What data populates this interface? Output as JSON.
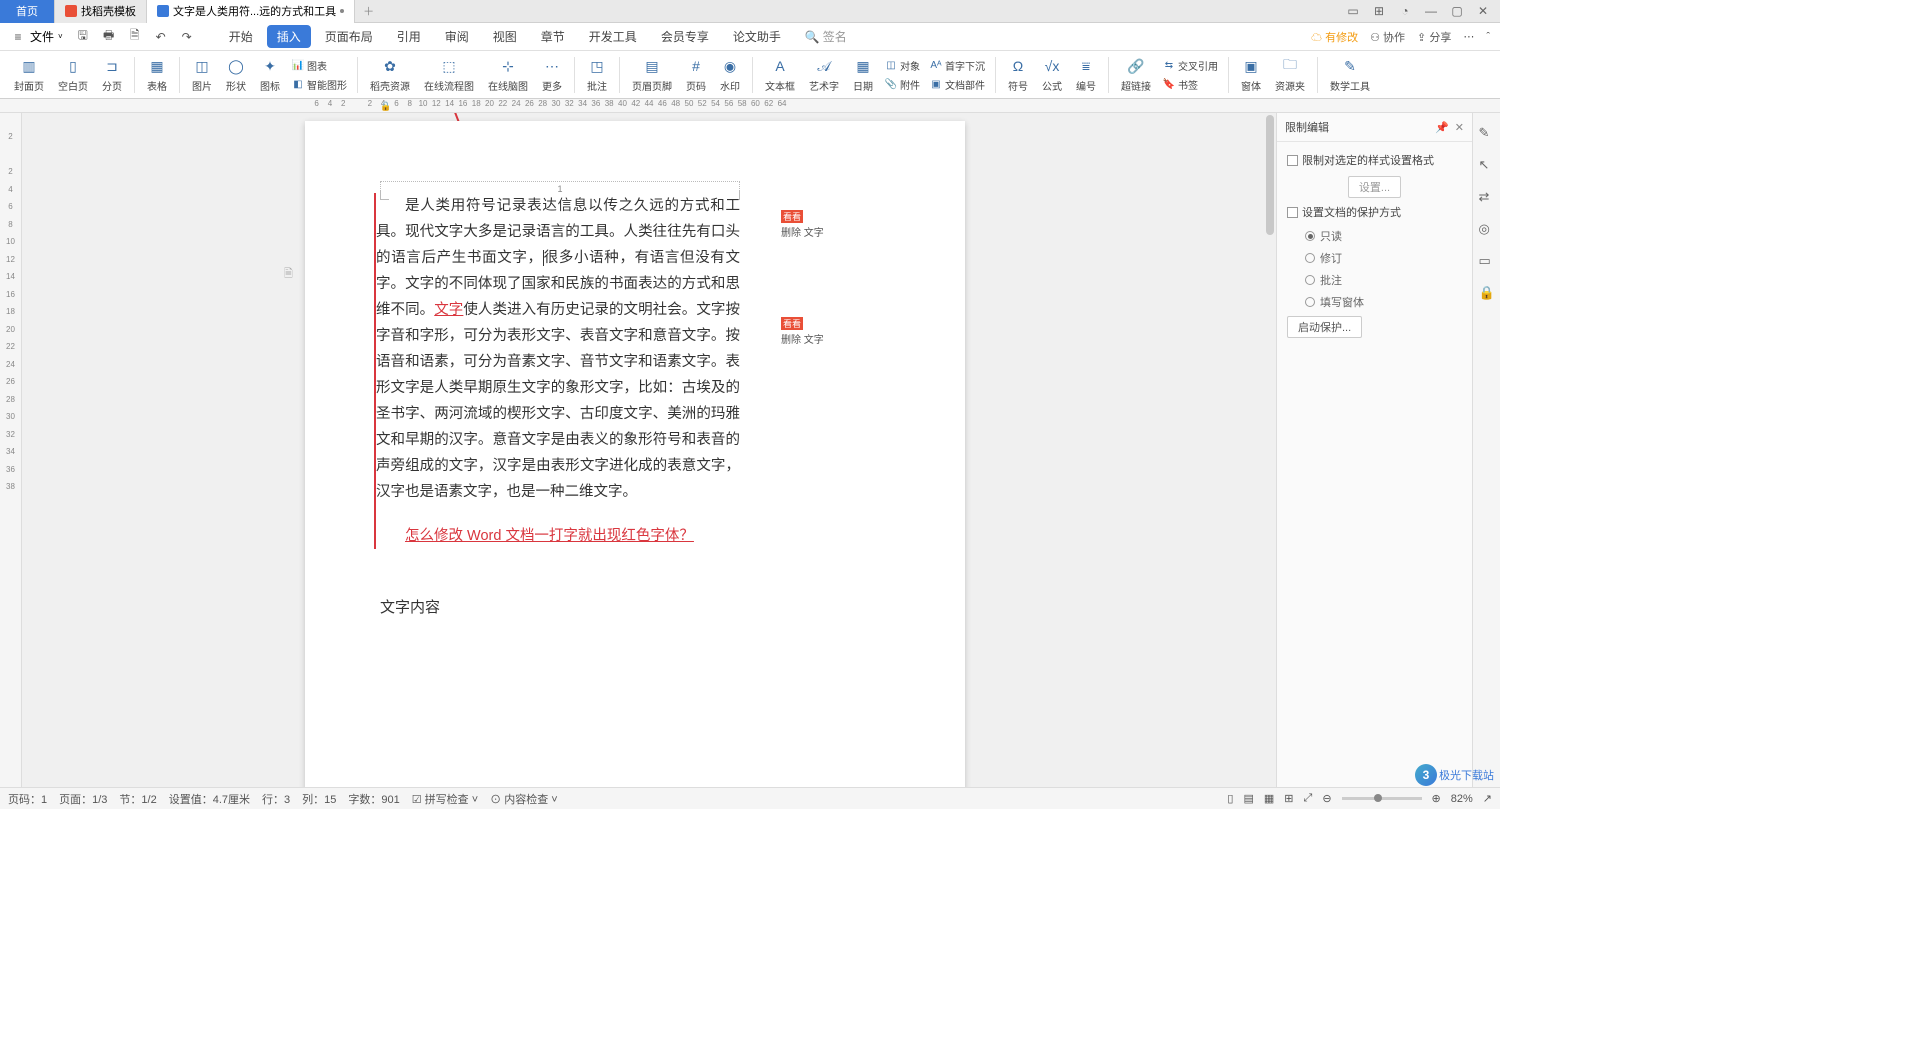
{
  "tabs": {
    "home": "首页",
    "templates": "找稻壳模板",
    "doc": "文字是人类用符...远的方式和工具"
  },
  "menu": {
    "file": "文件",
    "items": [
      "开始",
      "插入",
      "页面布局",
      "引用",
      "审阅",
      "视图",
      "章节",
      "开发工具",
      "会员专享",
      "论文助手"
    ],
    "active_index": 1,
    "sign": "签名",
    "right": {
      "track": "有修改",
      "collab": "协作",
      "share": "分享"
    }
  },
  "ribbon": {
    "cover": "封面页",
    "blank": "空白页",
    "section": "分页",
    "table": "表格",
    "image": "图片",
    "shape": "形状",
    "icon": "图标",
    "chart": "图表",
    "smart": "智能图形",
    "res": "稻壳资源",
    "flow": "在线流程图",
    "mind": "在线脑图",
    "more": "更多",
    "comment": "批注",
    "header": "页眉页脚",
    "pagenum": "页码",
    "water": "水印",
    "textbox": "文本框",
    "art": "艺术字",
    "date": "日期",
    "side1": "对象",
    "side2": "附件",
    "side3": "首字下沉",
    "side4": "文档部件",
    "symbol": "符号",
    "formula": "公式",
    "number": "编号",
    "hyper": "超链接",
    "cross": "交叉引用",
    "bookmark": "书签",
    "widget": "窗体",
    "resource": "资源夹",
    "teach": "数学工具"
  },
  "ruler": {
    "ticks": [
      "6",
      "4",
      "2",
      "",
      "2",
      "4",
      "6",
      "8",
      "10",
      "12",
      "14",
      "16",
      "18",
      "20",
      "22",
      "24",
      "26",
      "28",
      "30",
      "32",
      "34",
      "36",
      "38",
      "40",
      "42",
      "44",
      "46",
      "48",
      "50",
      "52",
      "54",
      "56",
      "58",
      "60",
      "62",
      "64"
    ],
    "pagenum": "1"
  },
  "vruler": [
    "2",
    "",
    "2",
    "4",
    "6",
    "8",
    "10",
    "12",
    "14",
    "16",
    "18",
    "20",
    "22",
    "24",
    "26",
    "28",
    "30",
    "32",
    "34",
    "36",
    "38"
  ],
  "doc": {
    "p1a": "是人类用符号记录表达信息以传之久远的方式和工具。现代文字大多是记录语言的工具。人类往往先有口头的语言后产生书面文字，",
    "p1b": "很多小语种，有语言但没有文字。文字的不同体现了国家和民族的书面表达的方式和思维不同。",
    "link1": "文字",
    "p1c": "使人类进入有历史记录的文明社会。文字按字音和字形，可分为表形文字、表音文字和意音文字。按语音和语素，可分为音素文字、音节文字和语素文字。表形文字是人类早期原生文字的象形文字，比如：古埃及的圣书字、两河流域的楔形文字、古印度文字、美洲的玛雅文和早期的汉字。意音文字是由表义的象形符号和表音的声旁组成的文字，汉字是由表形文字进化成的表意文字，汉字也是语素文字，也是一种二维文字。",
    "link2": "怎么修改 Word 文档一打字就出现红色字体？",
    "heading": "文字内容"
  },
  "balloons": {
    "author": "看看",
    "action": "删除 文字"
  },
  "panel": {
    "title": "限制编辑",
    "opt1": "限制对选定的样式设置格式",
    "settings": "设置...",
    "opt2": "设置文档的保护方式",
    "radios": [
      "只读",
      "修订",
      "批注",
      "填写窗体"
    ],
    "start": "启动保护..."
  },
  "status": {
    "page": "页码：1",
    "pages": "页面：1/3",
    "sec": "节：1/2",
    "pos": "设置值：4.7厘米",
    "row": "行：3",
    "col": "列：15",
    "words": "字数：901",
    "spell": "拼写检查",
    "content": "内容检查",
    "zoom": "82%"
  },
  "logo": "极光下载站"
}
